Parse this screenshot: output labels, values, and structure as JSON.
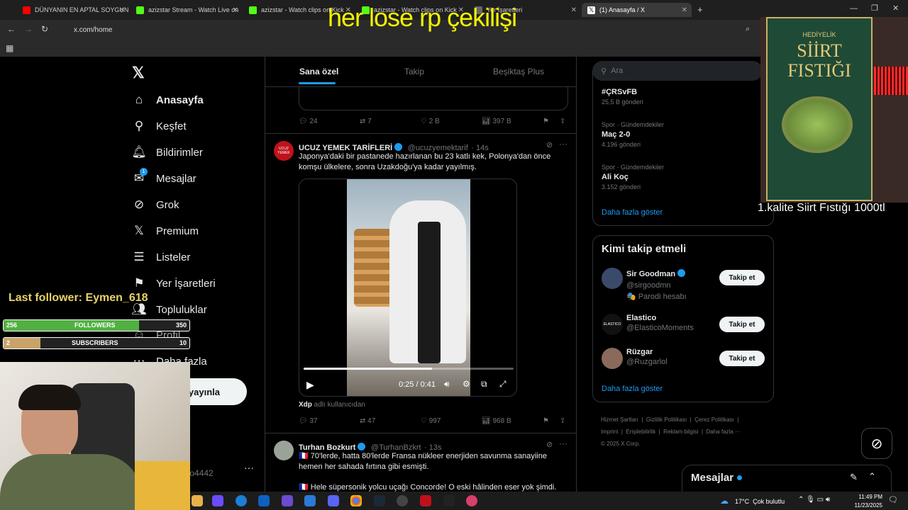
{
  "browser": {
    "tabs": [
      {
        "label": "DÜNYANIN EN APTAL SOYGUN",
        "color": "#ff0000"
      },
      {
        "label": "azizstar Stream - Watch Live on",
        "color": "#53fc18"
      },
      {
        "label": "azizstar - Watch clips on Kick",
        "color": "#53fc18"
      },
      {
        "label": "azizstar - Watch clips on Kick",
        "color": "#53fc18"
      },
      {
        "label": "Yer İşaretleri",
        "color": "#666666"
      },
      {
        "label": "(1) Anasayfa / X",
        "color": "#ffffff"
      }
    ],
    "url": "x.com/home"
  },
  "stream_overlay": {
    "top_text": "her lose rp çekilişi",
    "ad_text": "1.kalite Siirt Fıstığı 1000tl",
    "ad_box_title_small": "HEDİYELİK",
    "ad_box_title": "SİİRT FISTIĞI",
    "last_follower": "Last follower: Eymen_618",
    "followers_label": "FOLLOWERS",
    "followers_current": "256",
    "followers_goal": "350",
    "followers_progress": 0.73,
    "subscribers_label": "SUBSCRIBERS",
    "subscribers_current": "2",
    "subscribers_goal": "10",
    "subscribers_progress": 0.2
  },
  "sidebar": {
    "items": [
      {
        "label": "Anasayfa",
        "icon": "home-icon"
      },
      {
        "label": "Keşfet",
        "icon": "search-icon"
      },
      {
        "label": "Bildirimler",
        "icon": "bell-icon"
      },
      {
        "label": "Mesajlar",
        "icon": "mail-icon"
      },
      {
        "label": "Grok",
        "icon": "grok-icon"
      },
      {
        "label": "Premium",
        "icon": "x-icon"
      },
      {
        "label": "Listeler",
        "icon": "list-icon"
      },
      {
        "label": "Yer İşaretleri",
        "icon": "bookmark-icon"
      },
      {
        "label": "Topluluklar",
        "icon": "community-icon"
      },
      {
        "label": "Profil",
        "icon": "profile-icon"
      },
      {
        "label": "Daha fazla",
        "icon": "more-icon"
      }
    ],
    "post_button": "yayınla",
    "account_handle": "sto4442",
    "messages_badge": "1"
  },
  "feed": {
    "tabs": [
      "Sana özel",
      "Takip",
      "Beşiktaş Plus"
    ],
    "prev_post_actions": {
      "replies": "24",
      "reposts": "7",
      "likes": "2 B",
      "views": "397 B"
    },
    "post1": {
      "name": "UCUZ YEMEK TARİFLERİ",
      "handle": "@ucuzyemektarif",
      "time": "· 14s",
      "text": "Japonya'daki bir pastanede hazırlanan bu 23 katlı kek, Polonya'dan önce komşu ülkelere, sonra Uzakdoğu'ya kadar yayılmış.",
      "video_time": "0:25 / 0:41",
      "video_progress": 0.61,
      "credit_user": "Xdp",
      "credit_suffix": "adlı kullanıcıdan",
      "replies": "37",
      "reposts": "47",
      "likes": "997",
      "views": "968 B"
    },
    "post2": {
      "name": "Turhan Bozkurt",
      "handle": "@TurhanBzkrt",
      "time": "· 13s",
      "text1": "🇫🇷 70'lerde, hatta 80'lerde Fransa nükleer enerjiden savunma sanayiine hemen her sahada fırtına gibi esmişti.",
      "text2": "🇫🇷 Hele süpersonik yolcu uçağı Concorde! O eski hâlinden eser yok şimdi."
    }
  },
  "right": {
    "search_placeholder": "Ara",
    "trends": [
      {
        "meta": "",
        "name": "#ÇRSvFB",
        "count": "25,5 B gönderi"
      },
      {
        "meta": "Spor · Gündemdekiler",
        "name": "Maç 2-0",
        "count": "4.196 gönderi"
      },
      {
        "meta": "Spor · Gündemdekiler",
        "name": "Ali Koç",
        "count": "3.152 gönderi"
      }
    ],
    "trends_more": "Daha fazla göster",
    "who_to_follow_title": "Kimi takip etmeli",
    "suggestions": [
      {
        "name": "Sir Goodman",
        "handle": "@sirgoodmn",
        "note": "🎭 Parodi hesabı",
        "avatar_color": "#3a4a6a"
      },
      {
        "name": "Elastico",
        "handle": "@ElasticoMoments",
        "note": "",
        "avatar_color": "#111111"
      },
      {
        "name": "Rüzgar",
        "handle": "@Ruzgarlol",
        "note": "",
        "avatar_color": "#8a6a5a"
      }
    ],
    "follow_label": "Takip et",
    "suggest_more": "Daha fazla göster",
    "footer_links": [
      "Hizmet Şartları",
      "Gizlilik Politikası",
      "Çerez Politikası",
      "Imprint",
      "Erişilebilirlik",
      "Reklam bilgisi",
      "Daha fazla ···"
    ],
    "copyright": "© 2025 X Corp.",
    "messages_drawer": "Mesajlar"
  },
  "taskbar": {
    "weather": "17°C  Çok bulutlu",
    "time": "11:49 PM",
    "date": "11/23/2025"
  },
  "colors": {
    "accent": "#1d9bf0",
    "follow_bar": "#52b043",
    "sub_bar": "#c9a36a"
  }
}
